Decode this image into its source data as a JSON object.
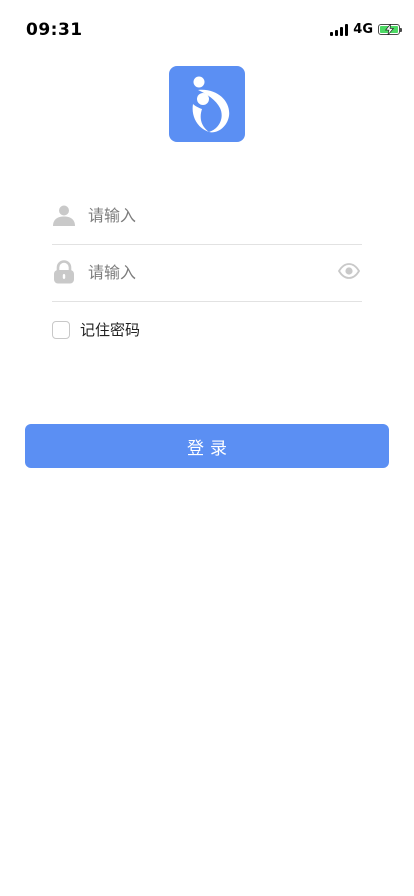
{
  "status_bar": {
    "time": "09:31",
    "network": "4G",
    "battery_color": "#4cd964",
    "signal_icon": "signal-bars-icon",
    "battery_icon": "battery-charging-icon"
  },
  "logo": {
    "icon": "mother-child-logo-icon",
    "background_color": "#5b8ff3"
  },
  "form": {
    "username": {
      "icon": "user-icon",
      "placeholder": "请输入",
      "value": ""
    },
    "password": {
      "icon": "lock-icon",
      "placeholder": "请输入",
      "value": "",
      "toggle_icon": "eye-icon"
    },
    "remember": {
      "label": "记住密码",
      "checked": false
    }
  },
  "login_button": {
    "label": "登录",
    "color": "#5b8ff3"
  }
}
